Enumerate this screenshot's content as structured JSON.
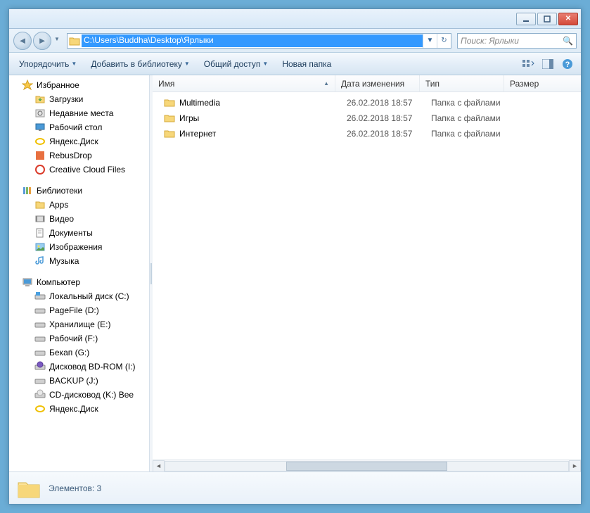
{
  "titlebar": {},
  "address": {
    "path": "C:\\Users\\Buddha\\Desktop\\Ярлыки"
  },
  "search": {
    "placeholder": "Поиск: Ярлыки"
  },
  "toolbar": {
    "organize": "Упорядочить",
    "add_library": "Добавить в библиотеку",
    "share": "Общий доступ",
    "new_folder": "Новая папка"
  },
  "sidebar": {
    "favorites": {
      "label": "Избранное",
      "items": [
        {
          "label": "Загрузки",
          "icon": "downloads"
        },
        {
          "label": "Недавние места",
          "icon": "recent"
        },
        {
          "label": "Рабочий стол",
          "icon": "desktop"
        },
        {
          "label": "Яндекс.Диск",
          "icon": "yadisk"
        },
        {
          "label": "RebusDrop",
          "icon": "rebus"
        },
        {
          "label": "Creative Cloud Files",
          "icon": "cc"
        }
      ]
    },
    "libraries": {
      "label": "Библиотеки",
      "items": [
        {
          "label": "Apps",
          "icon": "folder"
        },
        {
          "label": "Видео",
          "icon": "video"
        },
        {
          "label": "Документы",
          "icon": "documents"
        },
        {
          "label": "Изображения",
          "icon": "pictures"
        },
        {
          "label": "Музыка",
          "icon": "music"
        }
      ]
    },
    "computer": {
      "label": "Компьютер",
      "items": [
        {
          "label": "Локальный диск (C:)",
          "icon": "hdd-win"
        },
        {
          "label": "PageFile (D:)",
          "icon": "hdd"
        },
        {
          "label": "Хранилище (E:)",
          "icon": "hdd"
        },
        {
          "label": "Рабочий (F:)",
          "icon": "hdd"
        },
        {
          "label": "Бекап (G:)",
          "icon": "hdd"
        },
        {
          "label": "Дисковод BD-ROM (I:)",
          "icon": "bdrom"
        },
        {
          "label": "BACKUP (J:)",
          "icon": "hdd"
        },
        {
          "label": "CD-дисковод (K:) Bee",
          "icon": "cdrom"
        },
        {
          "label": "Яндекс.Диск",
          "icon": "yadisk"
        }
      ]
    }
  },
  "columns": {
    "name": "Имя",
    "date": "Дата изменения",
    "type": "Тип",
    "size": "Размер"
  },
  "files": [
    {
      "name": "Multimedia",
      "date": "26.02.2018 18:57",
      "type": "Папка с файлами"
    },
    {
      "name": "Игры",
      "date": "26.02.2018 18:57",
      "type": "Папка с файлами"
    },
    {
      "name": "Интернет",
      "date": "26.02.2018 18:57",
      "type": "Папка с файлами"
    }
  ],
  "status": {
    "text": "Элементов: 3"
  }
}
